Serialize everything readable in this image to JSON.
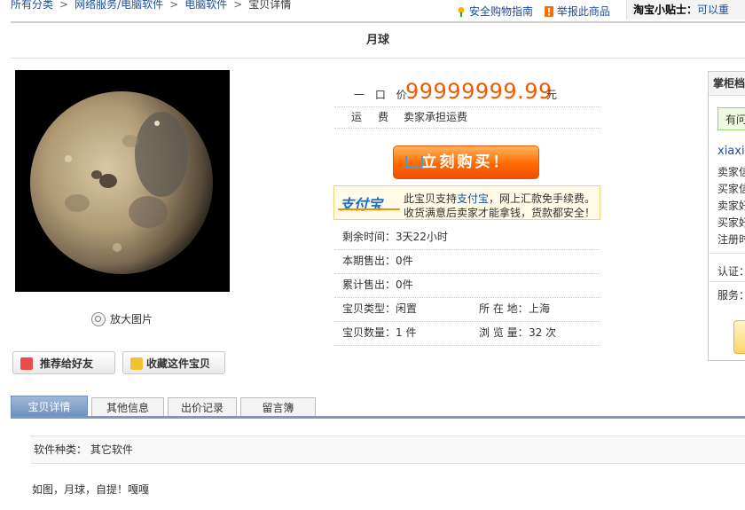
{
  "breadcrumb": {
    "items": [
      "所有分类",
      "网络服务/电脑软件",
      "电脑软件"
    ],
    "current": "宝贝详情",
    "separator": ">"
  },
  "toplinks": {
    "safe_guide": "安全购物指南",
    "report": "举报此商品"
  },
  "tip": {
    "label": "淘宝小贴士：",
    "text": "可以重"
  },
  "item": {
    "title": "月球",
    "price_label": "一 口 价：",
    "price": "99999999.99",
    "price_unit": "元",
    "shipping_label": "运费：",
    "shipping_value": "卖家承担运费",
    "zoom_label": "放大图片"
  },
  "buttons": {
    "buy_now": "立刻购买！",
    "recommend": "推荐给好友",
    "favorite": "收藏这件宝贝"
  },
  "alipay": {
    "logo_text": "支付宝",
    "line1_pre": "此宝贝支持",
    "line1_link": "支付宝",
    "line1_post": "，网上汇款免手续费。",
    "line2": "收货满意后卖家才能拿钱，货款都安全！"
  },
  "info": {
    "remaining_label": "剩余时间：",
    "remaining_value": "3天22小时",
    "period_sold_label": "本期售出：",
    "period_sold_value": "0件",
    "total_sold_label": "累计售出：",
    "total_sold_value": "0件",
    "type_label": "宝贝类型：",
    "type_value": "闲置",
    "location_label": "所 在 地：",
    "location_value": "上海",
    "qty_label": "宝贝数量：",
    "qty_value": "1 件",
    "views_label": "浏 览 量：",
    "views_value": "32 次"
  },
  "seller": {
    "header": "掌柜档",
    "ask": "有问",
    "name": "xiaxia",
    "lines": [
      "卖家信",
      "买家信",
      "卖家好",
      "买家好",
      "注册时"
    ],
    "cert": "认证：",
    "service": "服务："
  },
  "tabs": [
    {
      "label": "宝贝详情",
      "active": true
    },
    {
      "label": "其他信息",
      "active": false
    },
    {
      "label": "出价记录",
      "active": false
    },
    {
      "label": "留言簿",
      "active": false
    }
  ],
  "details": {
    "category_label": "软件种类：",
    "category_value": "其它软件"
  },
  "description": "如图，月球，自提！嘎嘎",
  "colors": {
    "price": "#f05a00",
    "link": "#1a4fa0",
    "tab_active": "#7a9ac4",
    "buy_button": "#ff6a00"
  }
}
